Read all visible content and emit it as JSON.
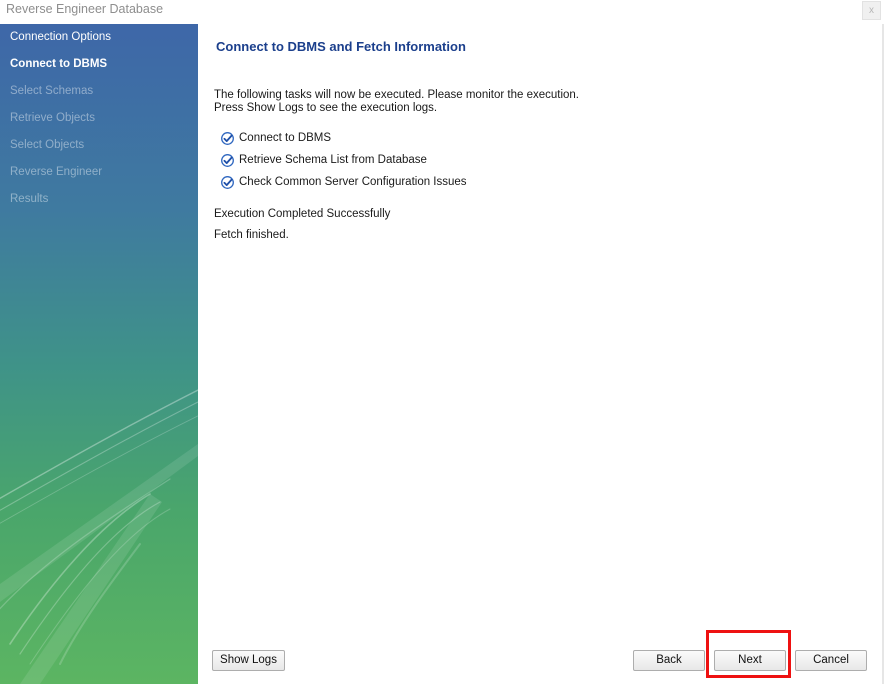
{
  "window": {
    "title": "Reverse Engineer Database",
    "close_glyph": "x"
  },
  "sidebar": {
    "steps": [
      {
        "label": "Connection Options",
        "state": "done"
      },
      {
        "label": "Connect to DBMS",
        "state": "active"
      },
      {
        "label": "Select Schemas",
        "state": "pending"
      },
      {
        "label": "Retrieve Objects",
        "state": "pending"
      },
      {
        "label": "Select Objects",
        "state": "pending"
      },
      {
        "label": "Reverse Engineer",
        "state": "pending"
      },
      {
        "label": "Results",
        "state": "pending"
      }
    ]
  },
  "main": {
    "title": "Connect to DBMS and Fetch Information",
    "description_lines": [
      "The following tasks will now be executed. Please monitor the execution.",
      "Press Show Logs to see the execution logs."
    ],
    "tasks": [
      {
        "label": "Connect to DBMS",
        "status": "done"
      },
      {
        "label": "Retrieve Schema List from Database",
        "status": "done"
      },
      {
        "label": "Check Common Server Configuration Issues",
        "status": "done"
      }
    ],
    "status_messages": [
      "Execution Completed Successfully",
      "Fetch finished."
    ]
  },
  "footer": {
    "show_logs_label": "Show Logs",
    "back_label": "Back",
    "next_label": "Next",
    "cancel_label": "Cancel"
  },
  "colors": {
    "title_blue": "#1b3f8c",
    "sidebar_top": "#3e67a8",
    "sidebar_bottom": "#5cb562",
    "check_blue": "#2f67c0",
    "highlight_red": "#ee1111"
  },
  "icons": {
    "task_status": "checkmark-icon",
    "close": "close-icon"
  }
}
